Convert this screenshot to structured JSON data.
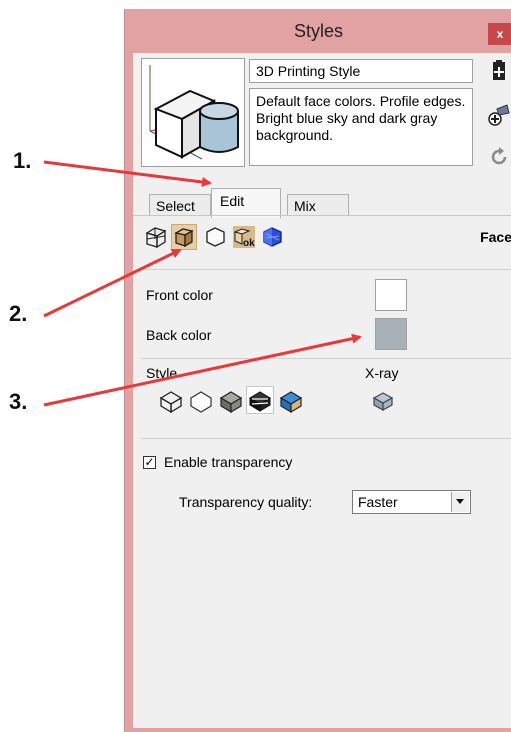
{
  "window": {
    "title": "Styles",
    "close_label": "x"
  },
  "style": {
    "name": "3D Printing Style",
    "description": "Default face colors. Profile edges. Bright blue sky and dark gray background."
  },
  "tabs": [
    {
      "label": "Select",
      "active": false
    },
    {
      "label": "Edit",
      "active": true
    },
    {
      "label": "Mix",
      "active": false
    }
  ],
  "section": {
    "label": "Face"
  },
  "face": {
    "front_label": "Front color",
    "front_color": "#ffffff",
    "back_label": "Back color",
    "back_color": "#a9b1b8",
    "style_label": "Style",
    "xray_label": "X-ray",
    "transparency_label": "Enable transparency",
    "transparency_checked": true,
    "quality_label": "Transparency quality:",
    "quality_value": "Faster"
  },
  "annotations": {
    "one": "1.",
    "two": "2.",
    "three": "3."
  },
  "colors": {
    "window_border": "#e2a1a3",
    "close_button": "#c7484a",
    "arrow": "#e8383a",
    "active_mode": "#e8cfa8"
  }
}
